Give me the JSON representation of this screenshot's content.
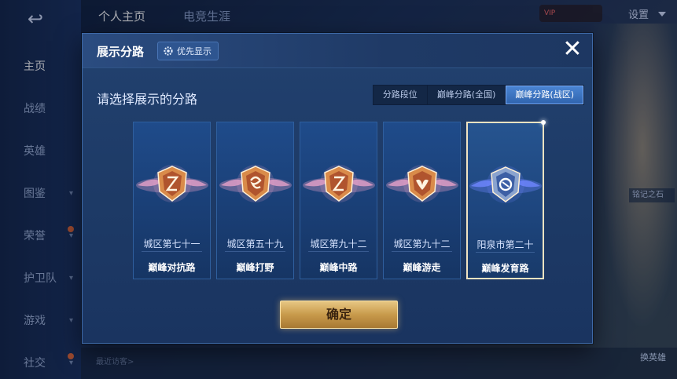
{
  "nav": {
    "back_glyph": "↩",
    "items": [
      {
        "label": "主页",
        "active": true,
        "chevron": false,
        "dot": false
      },
      {
        "label": "战绩",
        "active": false,
        "chevron": false,
        "dot": false
      },
      {
        "label": "英雄",
        "active": false,
        "chevron": false,
        "dot": false
      },
      {
        "label": "图鉴",
        "active": false,
        "chevron": true,
        "dot": false
      },
      {
        "label": "荣誉",
        "active": false,
        "chevron": true,
        "dot": true
      },
      {
        "label": "护卫队",
        "active": false,
        "chevron": true,
        "dot": false
      },
      {
        "label": "游戏",
        "active": false,
        "chevron": true,
        "dot": false
      },
      {
        "label": "社交",
        "active": false,
        "chevron": true,
        "dot": true
      }
    ]
  },
  "header": {
    "tabs": [
      "个人主页",
      "电竞生涯"
    ],
    "settings_label": "设置",
    "vip_text": "VIP"
  },
  "background": {
    "visitors_label": "最近访客>",
    "hero_switch_label": "换英雄",
    "side_tag": "铭记之石"
  },
  "modal": {
    "title": "展示分路",
    "priority_label": "优先显示",
    "close_glyph": "✕",
    "prompt": "请选择展示的分路",
    "segments": [
      {
        "label": "分路段位",
        "active": false
      },
      {
        "label": "巅峰分路(全国)",
        "active": false
      },
      {
        "label": "巅峰分路(战区)",
        "active": true
      }
    ],
    "cards": [
      {
        "rank": "城区第七十一",
        "route": "巅峰对抗路",
        "selected": false,
        "badge": "gold",
        "glyph": "sword"
      },
      {
        "rank": "城区第五十九",
        "route": "巅峰打野",
        "selected": false,
        "badge": "gold",
        "glyph": "swirl"
      },
      {
        "rank": "城区第九十二",
        "route": "巅峰中路",
        "selected": false,
        "badge": "gold",
        "glyph": "sword"
      },
      {
        "rank": "城区第九十二",
        "route": "巅峰游走",
        "selected": false,
        "badge": "gold",
        "glyph": "wings"
      },
      {
        "rank": "阳泉市第二十",
        "route": "巅峰发育路",
        "selected": true,
        "badge": "silver",
        "glyph": "ring"
      }
    ],
    "confirm_label": "确定"
  },
  "colors": {
    "gold_badge": "#d98b4a",
    "silver_badge": "#8aa3cf",
    "active_segment": "#3b75c6",
    "confirm_gold": "#c89a4b"
  }
}
